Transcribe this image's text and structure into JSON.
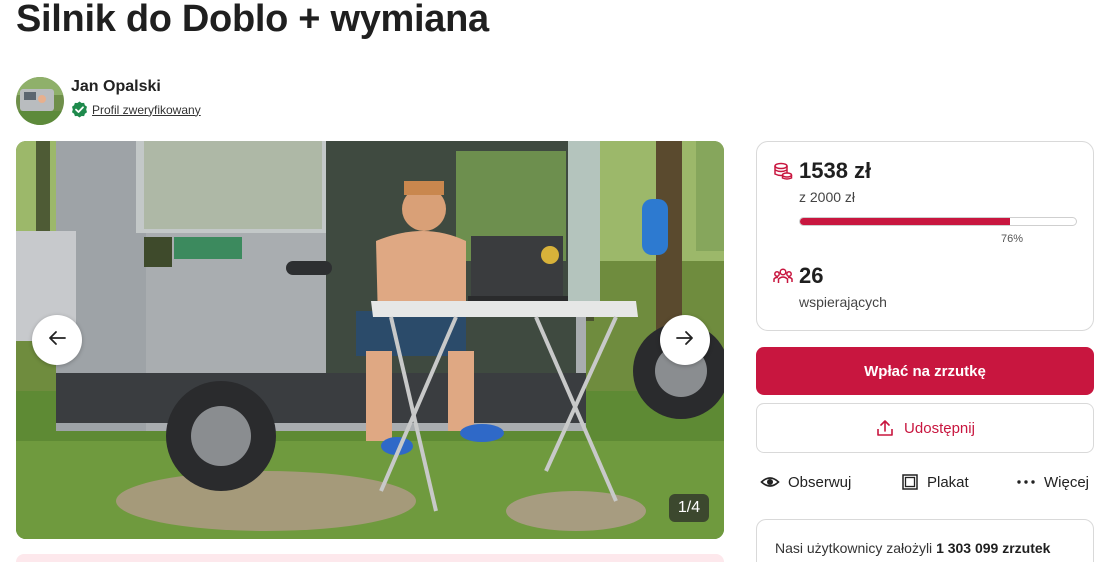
{
  "page": {
    "title": "Silnik do Doblo + wymiana"
  },
  "author": {
    "name": "Jan Opalski",
    "verified_label": "Profil zweryfikowany"
  },
  "gallery": {
    "counter": "1/4",
    "image_description_icon": "photo"
  },
  "stats": {
    "raised": "1538 zł",
    "goal": "z 2000 zł",
    "progress_percent": 76,
    "progress_label": "76%",
    "supporters_count": "26",
    "supporters_label": "wspierających"
  },
  "buttons": {
    "donate_label": "Wpłać na zrzutkę",
    "share_label": "Udostępnij",
    "observe_label": "Obserwuj",
    "poster_label": "Plakat",
    "more_label": "Więcej"
  },
  "footer_box": {
    "prefix": "Nasi użytkownicy założyli",
    "count": "1 303 099 zrzutek"
  },
  "colors": {
    "accent": "#c8163f",
    "verified": "#1e8a4c"
  }
}
